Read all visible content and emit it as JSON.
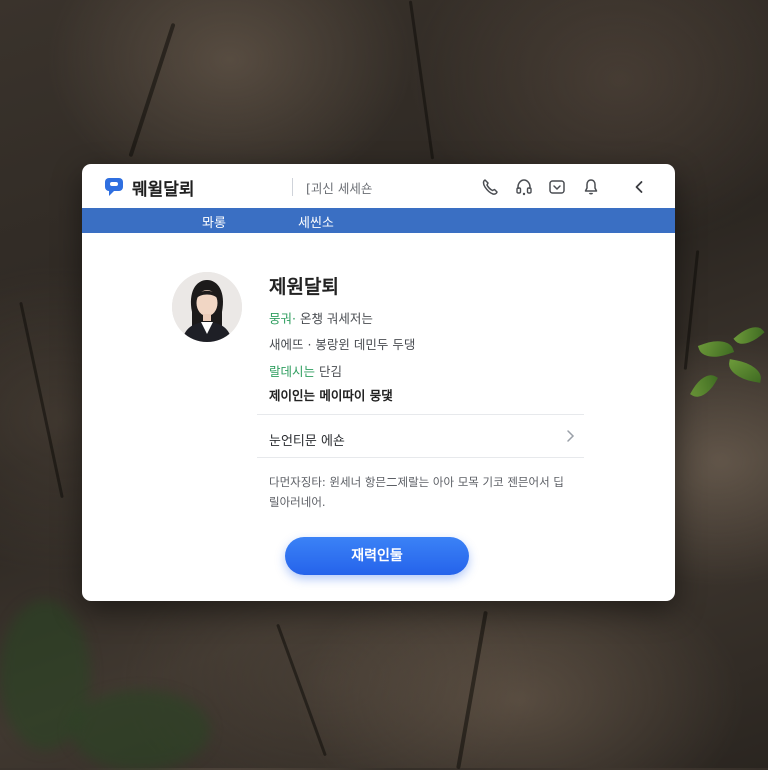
{
  "window": {
    "app_name": "뭬윌달뢰",
    "subtitle": "[괴신 세세숀"
  },
  "toolbar": {
    "icons": [
      "phone-icon",
      "headset-icon",
      "inbox-icon",
      "notification-icon",
      "back-arrow-icon"
    ]
  },
  "nav": {
    "tabs": [
      {
        "label": "뫄롱"
      },
      {
        "label": "세씬소"
      }
    ]
  },
  "profile": {
    "name": "제원달퇴",
    "line1_accent": "뭉궈·",
    "line1_text": " 온챙 궈세저는",
    "line2": "새에뜨 · 봉랑윈 데민두 두댕",
    "line3_accent": "랄데시는",
    "line3_text": " 단김",
    "line4": "제이인는 메이따이 뭉댗"
  },
  "row": {
    "label": "눈언티문 에숀"
  },
  "description": "다먼자징타:  윈세너 항믄二제랄는 아아 모목 기코 젠믄어서 딥릴아러네어.",
  "cta": {
    "label": "재력인둘"
  },
  "colors": {
    "brand_blue": "#3a6fc3",
    "accent_green": "#2f9e5f",
    "button_blue": "#2563eb"
  }
}
